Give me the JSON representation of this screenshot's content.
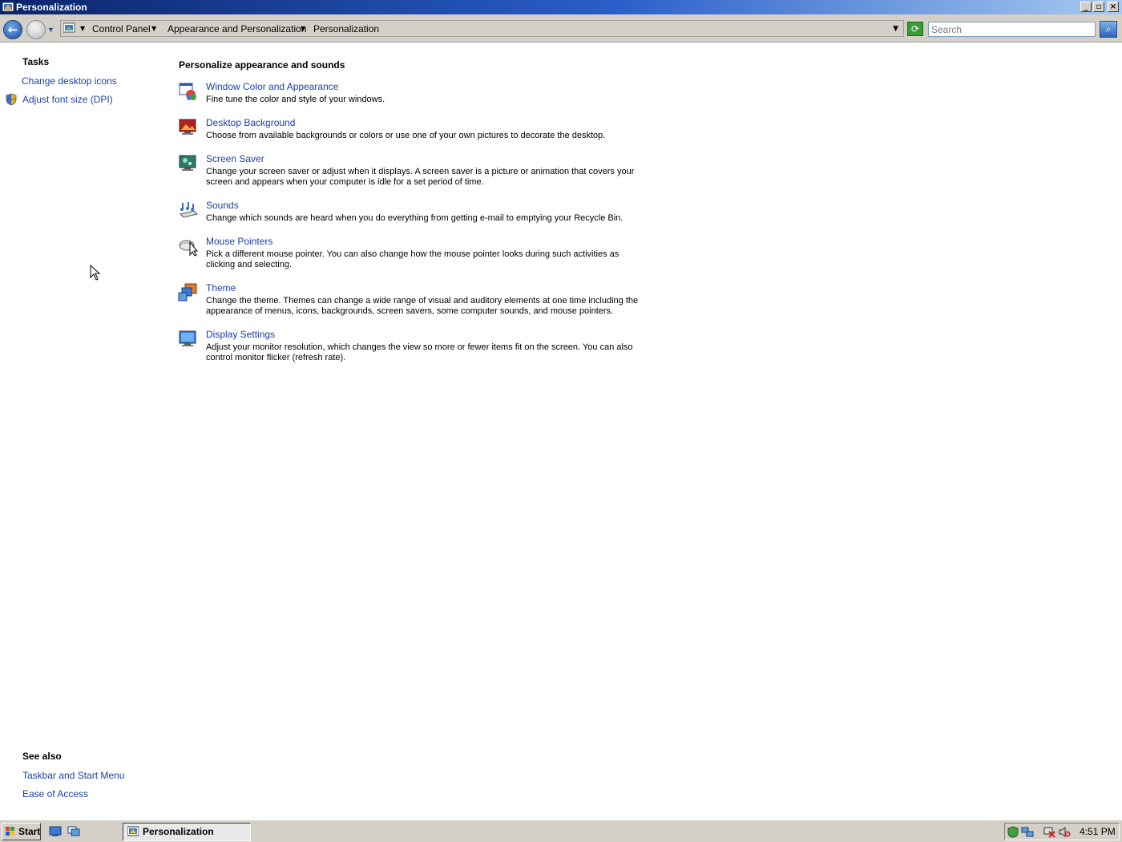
{
  "window": {
    "title": "Personalization"
  },
  "address_bar": {
    "breadcrumbs": [
      "Control Panel",
      "Appearance and Personalization",
      "Personalization"
    ],
    "search_placeholder": "Search"
  },
  "sidebar": {
    "tasks_heading": "Tasks",
    "tasks": [
      {
        "label": "Change desktop icons",
        "icon": "none"
      },
      {
        "label": "Adjust font size (DPI)",
        "icon": "shield-icon"
      }
    ],
    "see_also_heading": "See also",
    "see_also": [
      {
        "label": "Taskbar and Start Menu"
      },
      {
        "label": "Ease of Access"
      }
    ]
  },
  "main": {
    "heading": "Personalize appearance and sounds",
    "items": [
      {
        "title": "Window Color and Appearance",
        "description": "Fine tune the color and style of your windows.",
        "icon": "window-color-icon"
      },
      {
        "title": "Desktop Background",
        "description": "Choose from available backgrounds or colors or use one of your own pictures to decorate the desktop.",
        "icon": "desktop-background-icon"
      },
      {
        "title": "Screen Saver",
        "description": "Change your screen saver or adjust when it displays. A screen saver is a picture or animation that covers your screen and appears when your computer is idle for a set period of time.",
        "icon": "screen-saver-icon"
      },
      {
        "title": "Sounds",
        "description": "Change which sounds are heard when you do everything from getting e-mail to emptying your Recycle Bin.",
        "icon": "sounds-icon"
      },
      {
        "title": "Mouse Pointers",
        "description": "Pick a different mouse pointer. You can also change how the mouse pointer looks during such activities as clicking and selecting.",
        "icon": "mouse-pointers-icon"
      },
      {
        "title": "Theme",
        "description": "Change the theme. Themes can change a wide range of visual and auditory elements at one time including the appearance of menus, icons, backgrounds, screen savers, some computer sounds, and mouse pointers.",
        "icon": "theme-icon"
      },
      {
        "title": "Display Settings",
        "description": "Adjust your monitor resolution, which changes the view so more or fewer items fit on the screen. You can also control monitor flicker (refresh rate).",
        "icon": "display-settings-icon"
      }
    ]
  },
  "taskbar": {
    "start_label": "Start",
    "active_task": "Personalization",
    "clock": "4:51 PM"
  },
  "colors": {
    "link": "#1a3fa6",
    "titlebar_start": "#0a246a",
    "titlebar_end": "#a6caf0",
    "chrome": "#d4d0c8"
  }
}
